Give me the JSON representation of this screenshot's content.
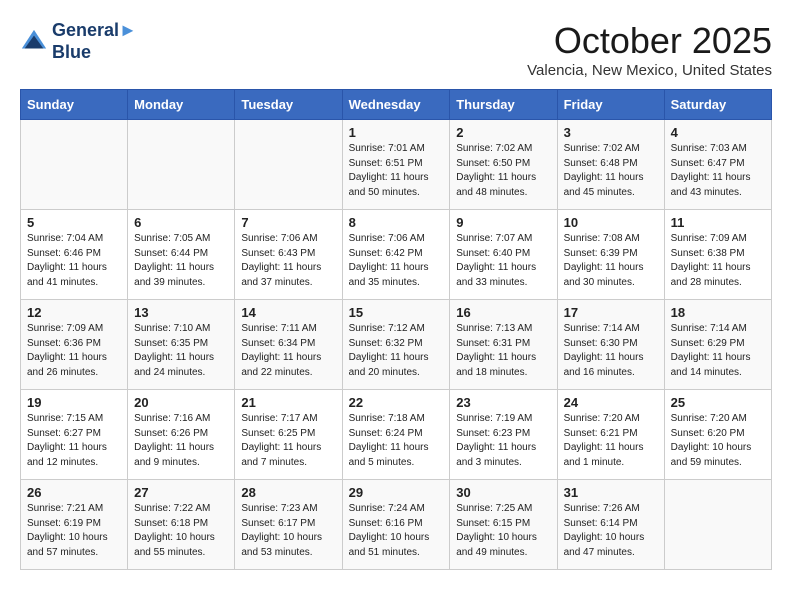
{
  "header": {
    "logo_line1": "General",
    "logo_line2": "Blue",
    "title": "October 2025",
    "subtitle": "Valencia, New Mexico, United States"
  },
  "weekdays": [
    "Sunday",
    "Monday",
    "Tuesday",
    "Wednesday",
    "Thursday",
    "Friday",
    "Saturday"
  ],
  "weeks": [
    [
      {
        "day": "",
        "sunrise": "",
        "sunset": "",
        "daylight": ""
      },
      {
        "day": "",
        "sunrise": "",
        "sunset": "",
        "daylight": ""
      },
      {
        "day": "",
        "sunrise": "",
        "sunset": "",
        "daylight": ""
      },
      {
        "day": "1",
        "sunrise": "Sunrise: 7:01 AM",
        "sunset": "Sunset: 6:51 PM",
        "daylight": "Daylight: 11 hours and 50 minutes."
      },
      {
        "day": "2",
        "sunrise": "Sunrise: 7:02 AM",
        "sunset": "Sunset: 6:50 PM",
        "daylight": "Daylight: 11 hours and 48 minutes."
      },
      {
        "day": "3",
        "sunrise": "Sunrise: 7:02 AM",
        "sunset": "Sunset: 6:48 PM",
        "daylight": "Daylight: 11 hours and 45 minutes."
      },
      {
        "day": "4",
        "sunrise": "Sunrise: 7:03 AM",
        "sunset": "Sunset: 6:47 PM",
        "daylight": "Daylight: 11 hours and 43 minutes."
      }
    ],
    [
      {
        "day": "5",
        "sunrise": "Sunrise: 7:04 AM",
        "sunset": "Sunset: 6:46 PM",
        "daylight": "Daylight: 11 hours and 41 minutes."
      },
      {
        "day": "6",
        "sunrise": "Sunrise: 7:05 AM",
        "sunset": "Sunset: 6:44 PM",
        "daylight": "Daylight: 11 hours and 39 minutes."
      },
      {
        "day": "7",
        "sunrise": "Sunrise: 7:06 AM",
        "sunset": "Sunset: 6:43 PM",
        "daylight": "Daylight: 11 hours and 37 minutes."
      },
      {
        "day": "8",
        "sunrise": "Sunrise: 7:06 AM",
        "sunset": "Sunset: 6:42 PM",
        "daylight": "Daylight: 11 hours and 35 minutes."
      },
      {
        "day": "9",
        "sunrise": "Sunrise: 7:07 AM",
        "sunset": "Sunset: 6:40 PM",
        "daylight": "Daylight: 11 hours and 33 minutes."
      },
      {
        "day": "10",
        "sunrise": "Sunrise: 7:08 AM",
        "sunset": "Sunset: 6:39 PM",
        "daylight": "Daylight: 11 hours and 30 minutes."
      },
      {
        "day": "11",
        "sunrise": "Sunrise: 7:09 AM",
        "sunset": "Sunset: 6:38 PM",
        "daylight": "Daylight: 11 hours and 28 minutes."
      }
    ],
    [
      {
        "day": "12",
        "sunrise": "Sunrise: 7:09 AM",
        "sunset": "Sunset: 6:36 PM",
        "daylight": "Daylight: 11 hours and 26 minutes."
      },
      {
        "day": "13",
        "sunrise": "Sunrise: 7:10 AM",
        "sunset": "Sunset: 6:35 PM",
        "daylight": "Daylight: 11 hours and 24 minutes."
      },
      {
        "day": "14",
        "sunrise": "Sunrise: 7:11 AM",
        "sunset": "Sunset: 6:34 PM",
        "daylight": "Daylight: 11 hours and 22 minutes."
      },
      {
        "day": "15",
        "sunrise": "Sunrise: 7:12 AM",
        "sunset": "Sunset: 6:32 PM",
        "daylight": "Daylight: 11 hours and 20 minutes."
      },
      {
        "day": "16",
        "sunrise": "Sunrise: 7:13 AM",
        "sunset": "Sunset: 6:31 PM",
        "daylight": "Daylight: 11 hours and 18 minutes."
      },
      {
        "day": "17",
        "sunrise": "Sunrise: 7:14 AM",
        "sunset": "Sunset: 6:30 PM",
        "daylight": "Daylight: 11 hours and 16 minutes."
      },
      {
        "day": "18",
        "sunrise": "Sunrise: 7:14 AM",
        "sunset": "Sunset: 6:29 PM",
        "daylight": "Daylight: 11 hours and 14 minutes."
      }
    ],
    [
      {
        "day": "19",
        "sunrise": "Sunrise: 7:15 AM",
        "sunset": "Sunset: 6:27 PM",
        "daylight": "Daylight: 11 hours and 12 minutes."
      },
      {
        "day": "20",
        "sunrise": "Sunrise: 7:16 AM",
        "sunset": "Sunset: 6:26 PM",
        "daylight": "Daylight: 11 hours and 9 minutes."
      },
      {
        "day": "21",
        "sunrise": "Sunrise: 7:17 AM",
        "sunset": "Sunset: 6:25 PM",
        "daylight": "Daylight: 11 hours and 7 minutes."
      },
      {
        "day": "22",
        "sunrise": "Sunrise: 7:18 AM",
        "sunset": "Sunset: 6:24 PM",
        "daylight": "Daylight: 11 hours and 5 minutes."
      },
      {
        "day": "23",
        "sunrise": "Sunrise: 7:19 AM",
        "sunset": "Sunset: 6:23 PM",
        "daylight": "Daylight: 11 hours and 3 minutes."
      },
      {
        "day": "24",
        "sunrise": "Sunrise: 7:20 AM",
        "sunset": "Sunset: 6:21 PM",
        "daylight": "Daylight: 11 hours and 1 minute."
      },
      {
        "day": "25",
        "sunrise": "Sunrise: 7:20 AM",
        "sunset": "Sunset: 6:20 PM",
        "daylight": "Daylight: 10 hours and 59 minutes."
      }
    ],
    [
      {
        "day": "26",
        "sunrise": "Sunrise: 7:21 AM",
        "sunset": "Sunset: 6:19 PM",
        "daylight": "Daylight: 10 hours and 57 minutes."
      },
      {
        "day": "27",
        "sunrise": "Sunrise: 7:22 AM",
        "sunset": "Sunset: 6:18 PM",
        "daylight": "Daylight: 10 hours and 55 minutes."
      },
      {
        "day": "28",
        "sunrise": "Sunrise: 7:23 AM",
        "sunset": "Sunset: 6:17 PM",
        "daylight": "Daylight: 10 hours and 53 minutes."
      },
      {
        "day": "29",
        "sunrise": "Sunrise: 7:24 AM",
        "sunset": "Sunset: 6:16 PM",
        "daylight": "Daylight: 10 hours and 51 minutes."
      },
      {
        "day": "30",
        "sunrise": "Sunrise: 7:25 AM",
        "sunset": "Sunset: 6:15 PM",
        "daylight": "Daylight: 10 hours and 49 minutes."
      },
      {
        "day": "31",
        "sunrise": "Sunrise: 7:26 AM",
        "sunset": "Sunset: 6:14 PM",
        "daylight": "Daylight: 10 hours and 47 minutes."
      },
      {
        "day": "",
        "sunrise": "",
        "sunset": "",
        "daylight": ""
      }
    ]
  ]
}
